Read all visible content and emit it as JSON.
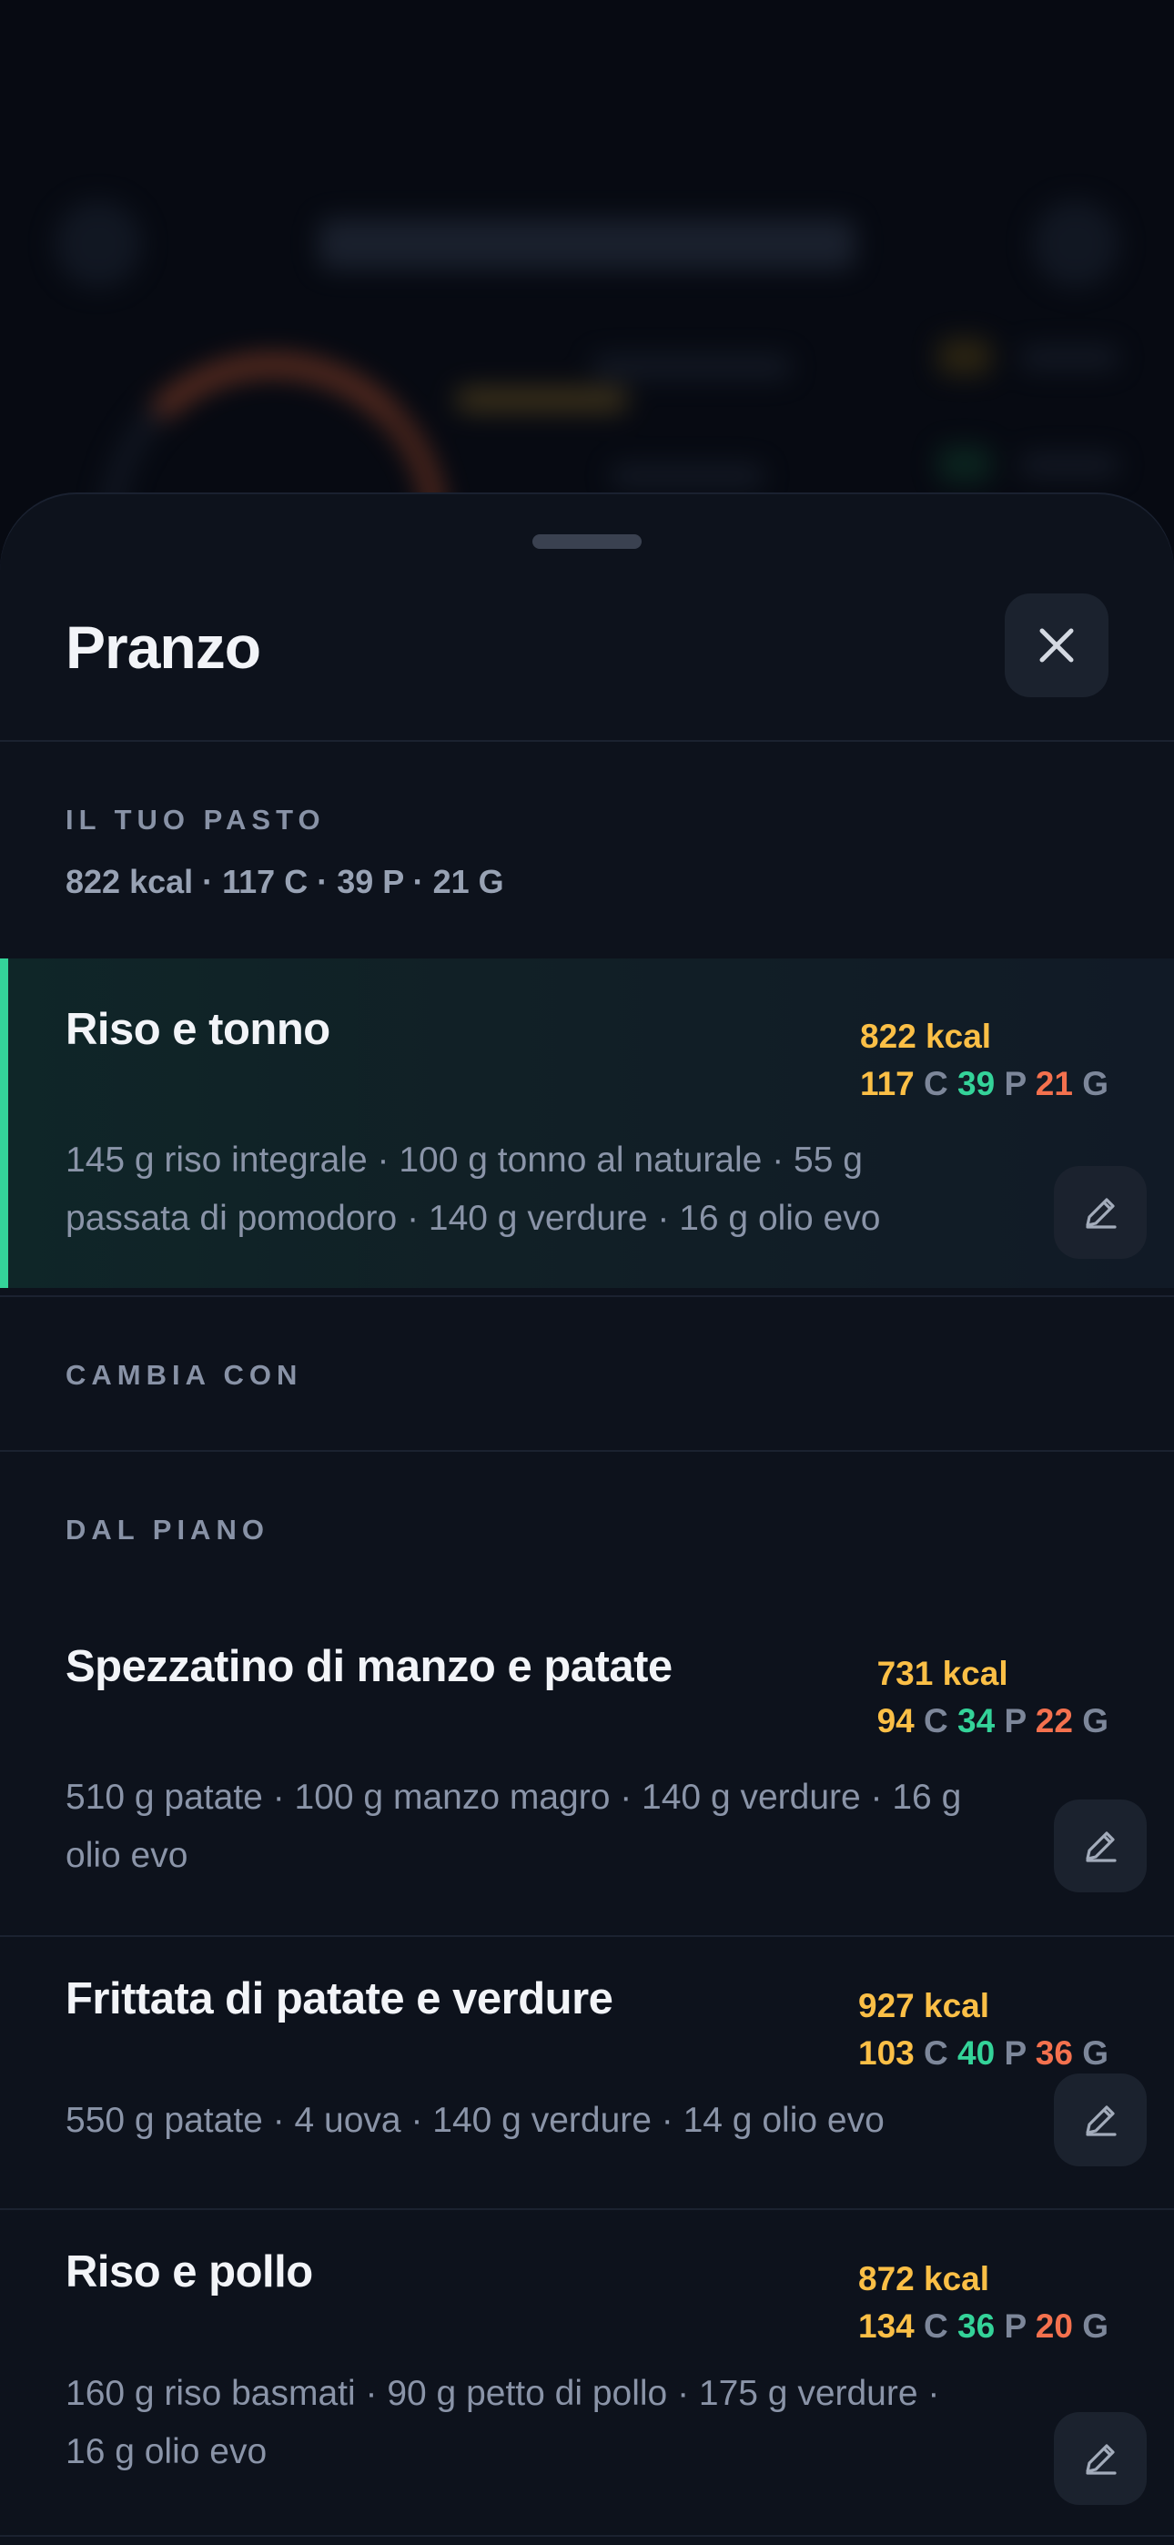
{
  "sheet": {
    "title": "Pranzo",
    "current_section_label": "IL TUO PASTO",
    "summary": "822 kcal · 117 C · 39 P · 21 G",
    "swap_section_label": "CAMBIA CON",
    "plan_section_label": "DAL PIANO"
  },
  "current_meal": {
    "name": "Riso e tonno",
    "kcal": "822 kcal",
    "c": "117",
    "p": "39",
    "g": "21",
    "description": "145 g riso integrale · 100 g tonno al naturale · 55 g passata di pomodoro · 140 g verdure · 16 g olio evo"
  },
  "macro_units": {
    "c": "C",
    "p": "P",
    "g": "G"
  },
  "alternatives": [
    {
      "name": "Spezzatino di manzo e patate",
      "kcal": "731 kcal",
      "c": "94",
      "p": "34",
      "g": "22",
      "description": "510 g patate · 100 g manzo magro · 140 g verdure · 16 g olio evo"
    },
    {
      "name": "Frittata di patate e verdure",
      "kcal": "927 kcal",
      "c": "103",
      "p": "40",
      "g": "36",
      "description": "550 g patate · 4 uova · 140 g verdure · 14 g olio evo"
    },
    {
      "name": "Riso e pollo",
      "kcal": "872 kcal",
      "c": "134",
      "p": "36",
      "g": "20",
      "description": "160 g riso basmati · 90 g petto di pollo · 175 g verdure · 16 g olio evo"
    }
  ],
  "icons": {
    "close": "close-icon",
    "edit": "pencil-icon"
  },
  "colors": {
    "kcal": "#fbbf46",
    "carbs": "#fbbf46",
    "protein": "#34d399",
    "fat": "#f4714e",
    "accent": "#34d399"
  }
}
